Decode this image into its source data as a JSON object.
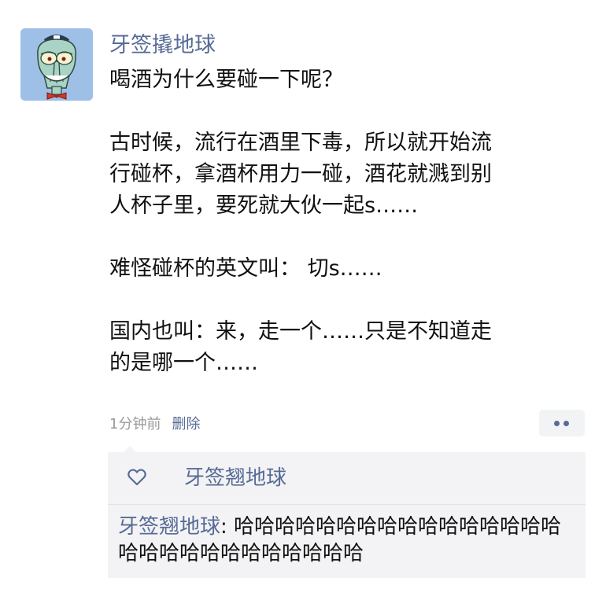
{
  "post": {
    "author": "牙签撬地球",
    "avatar_icon": "squidward-avatar",
    "lines_group1": [
      "喝酒为什么要碰一下呢？"
    ],
    "lines_group2": [
      "古时候，流行在酒里下毒，所以就开始流",
      "行碰杯，拿酒杯用力一碰，酒花就溅到别",
      "人杯子里，要死就大伙一起s……"
    ],
    "lines_group3": [
      "难怪碰杯的英文叫：  切s……"
    ],
    "lines_group4": [
      "国内也叫：来，走一个……只是不知道走",
      "的是哪一个……"
    ],
    "time": "1分钟前",
    "delete_label": "删除"
  },
  "interactions": {
    "like_icon": "heart-outline-icon",
    "liker": "牙签翘地球",
    "comment": {
      "author": "牙签翘地球",
      "separator": ": ",
      "text": "哈哈哈哈哈哈哈哈哈哈哈哈哈哈哈哈哈哈哈哈哈哈哈哈哈哈哈哈"
    }
  },
  "colors": {
    "link": "#576b95",
    "meta": "#9a9a9a",
    "panel": "#f3f3f5",
    "avatar_bg": "#9fc0e6"
  }
}
